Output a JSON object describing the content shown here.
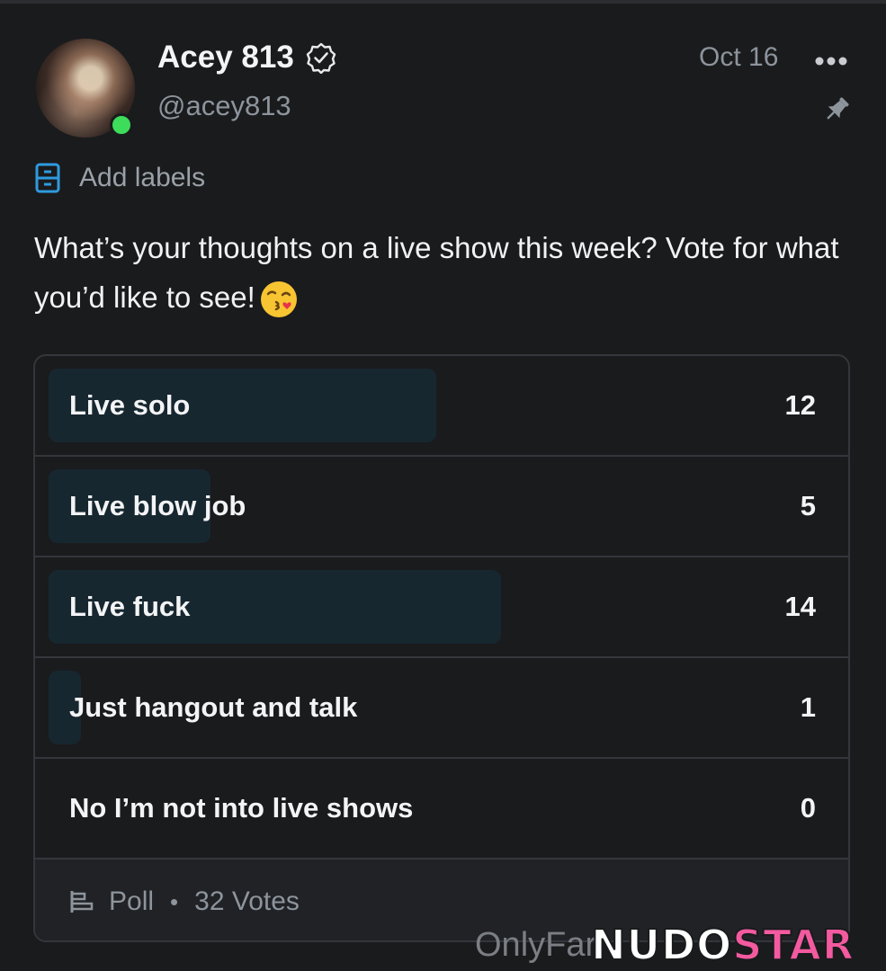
{
  "post": {
    "author_name": "Acey 813",
    "handle": "@acey813",
    "date": "Oct 16",
    "labels_action": "Add labels",
    "text": "What’s your thoughts on a live show this week? Vote for what you’d like to see!",
    "emoji": "😘",
    "online": true
  },
  "poll": {
    "options": [
      {
        "label": "Live solo",
        "count": "12",
        "votes": 12
      },
      {
        "label": "Live blow job",
        "count": "5",
        "votes": 5
      },
      {
        "label": "Live fuck",
        "count": "14",
        "votes": 14
      },
      {
        "label": "Just hangout and talk",
        "count": "1",
        "votes": 1
      },
      {
        "label": "No I’m not into live shows",
        "count": "0",
        "votes": 0
      }
    ],
    "type_label": "Poll",
    "separator": "•",
    "total_votes": "32 Votes"
  },
  "watermark": {
    "prefix": "OnlyFar",
    "brand_a": "NUDO",
    "brand_b": "STAR"
  },
  "colors": {
    "background": "#1a1b1d",
    "bar_fill": "#172730",
    "online": "#3ddc5a",
    "label_icon": "#2f9be0",
    "watermark_accent": "#f45aa0"
  }
}
